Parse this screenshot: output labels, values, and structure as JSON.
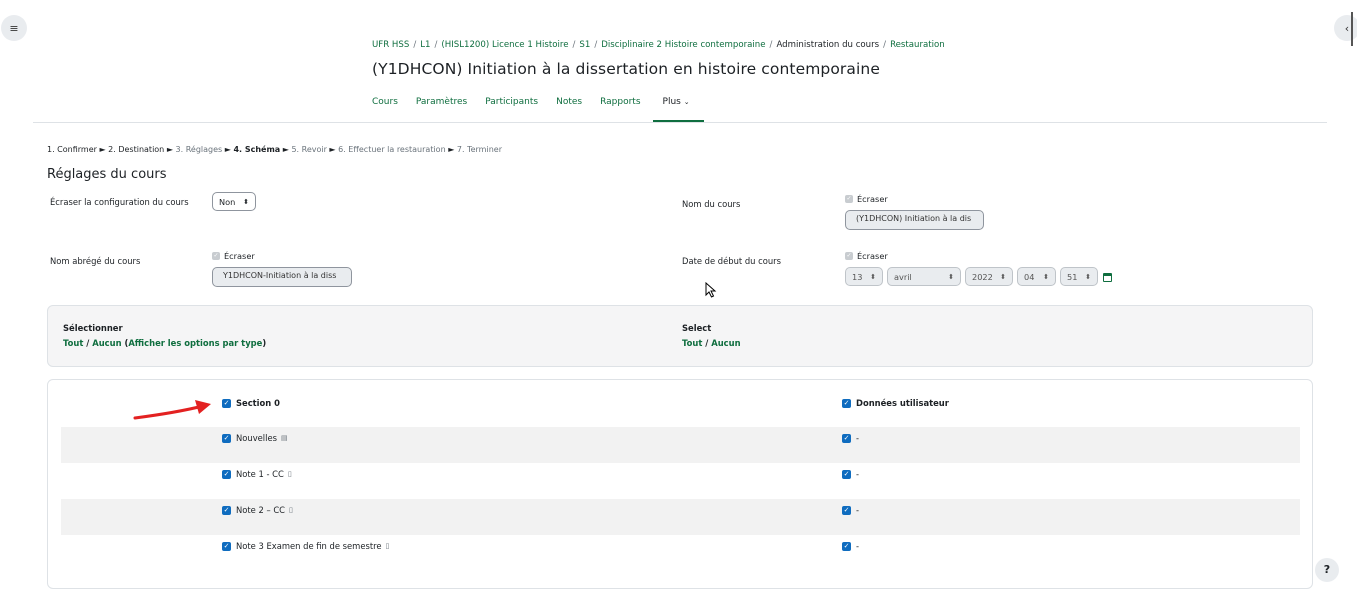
{
  "breadcrumb": [
    {
      "label": "UFR HSS",
      "link": true
    },
    {
      "label": "L1",
      "link": true
    },
    {
      "label": "(HISL1200) Licence 1 Histoire",
      "link": true
    },
    {
      "label": "S1",
      "link": true
    },
    {
      "label": "Disciplinaire 2 Histoire contemporaine",
      "link": true
    },
    {
      "label": "Administration du cours",
      "link": false
    },
    {
      "label": "Restauration",
      "link": true
    }
  ],
  "page_title": "(Y1DHCON) Initiation à la dissertation en histoire contemporaine",
  "course_nav": [
    "Cours",
    "Paramètres",
    "Participants",
    "Notes",
    "Rapports"
  ],
  "course_nav_more": "Plus",
  "stepper": {
    "s1": "1. Confirmer",
    "s2": "2. Destination",
    "s3": "3. Réglages",
    "s4": "4. Schéma",
    "s5": "5. Revoir",
    "s6": "6. Effectuer la restauration",
    "s7": "7. Terminer",
    "arrow": "►"
  },
  "section_title": "Réglages du cours",
  "settings": {
    "overwrite_config_label": "Écraser la configuration du cours",
    "overwrite_config_value": "Non",
    "course_name_label": "Nom du cours",
    "course_name_overwrite": "Écraser",
    "course_name_value": "(Y1DHCON) Initiation à la dis",
    "shortname_label": "Nom abrégé du cours",
    "shortname_overwrite": "Écraser",
    "shortname_value": "Y1DHCON-Initiation à la diss",
    "startdate_label": "Date de début du cours",
    "startdate_overwrite": "Écraser",
    "day": "13",
    "month": "avril",
    "year": "2022",
    "hour": "04",
    "minute": "51"
  },
  "select_panel": {
    "left_title": "Sélectionner",
    "left_all": "Tout",
    "left_none": "Aucun",
    "left_by_type": "Afficher les options par type",
    "right_title": "Select",
    "right_all": "Tout",
    "right_none": "Aucun",
    "slash": "/"
  },
  "sections": {
    "section0": "Section 0",
    "user_data": "Données utilisateur",
    "items": [
      {
        "name": "Nouvelles",
        "icon": "forum-icon",
        "user_data": "-"
      },
      {
        "name": "Note 1 - CC",
        "icon": "assignment-icon",
        "user_data": "-"
      },
      {
        "name": "Note 2 – CC",
        "icon": "assignment-icon",
        "user_data": "-"
      },
      {
        "name": "Note 3 Examen de fin de semestre",
        "icon": "assignment-icon",
        "user_data": "-"
      }
    ]
  },
  "help": "?",
  "colors": {
    "accent": "#0f6e3f",
    "checkbox": "#0f6cbf",
    "arrow": "#e32121"
  }
}
